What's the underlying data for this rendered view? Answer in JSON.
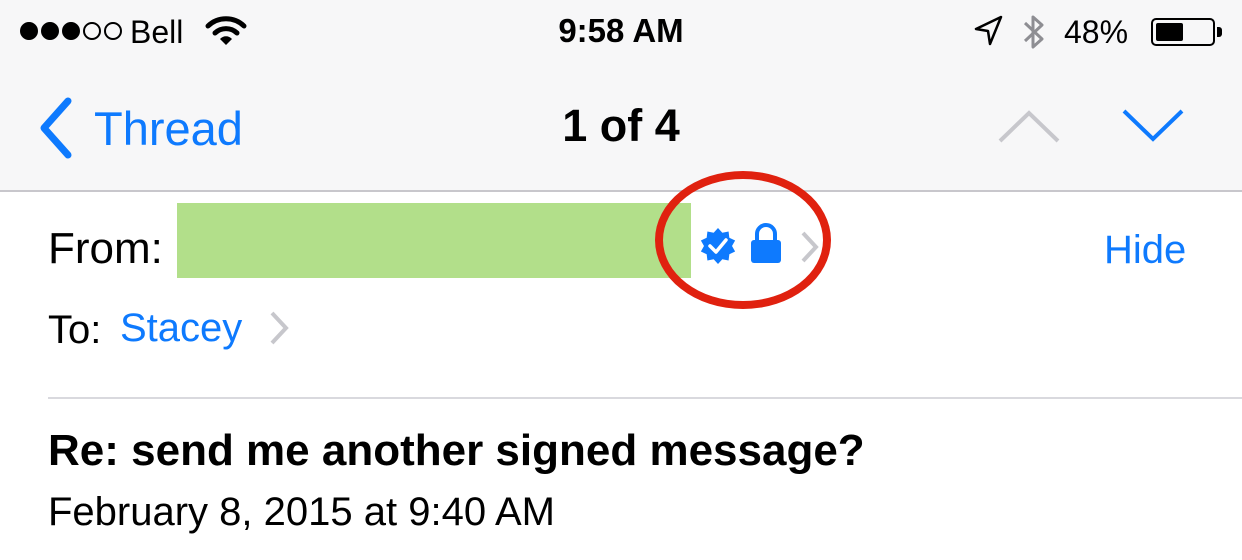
{
  "status_bar": {
    "signal_filled": 3,
    "signal_total": 5,
    "carrier": "Bell",
    "time": "9:58 AM",
    "battery_percent": "48%",
    "battery_level": 0.48
  },
  "nav": {
    "back_label": "Thread",
    "title": "1 of 4"
  },
  "header": {
    "from_label": "From:",
    "hide_label": "Hide",
    "to_label": "To:",
    "to_name": "Stacey"
  },
  "message": {
    "subject": "Re: send me another signed message?",
    "date": "February 8, 2015 at 9:40 AM"
  },
  "colors": {
    "accent": "#0e7afe",
    "highlight_circle": "#e0210f",
    "redaction": "#b2df8a"
  },
  "icons": [
    "wifi-icon",
    "location-arrow-icon",
    "bluetooth-icon",
    "battery-icon",
    "back-chevron-icon",
    "up-arrow-icon",
    "down-arrow-icon",
    "verified-badge-icon",
    "lock-icon",
    "chevron-right-icon"
  ]
}
